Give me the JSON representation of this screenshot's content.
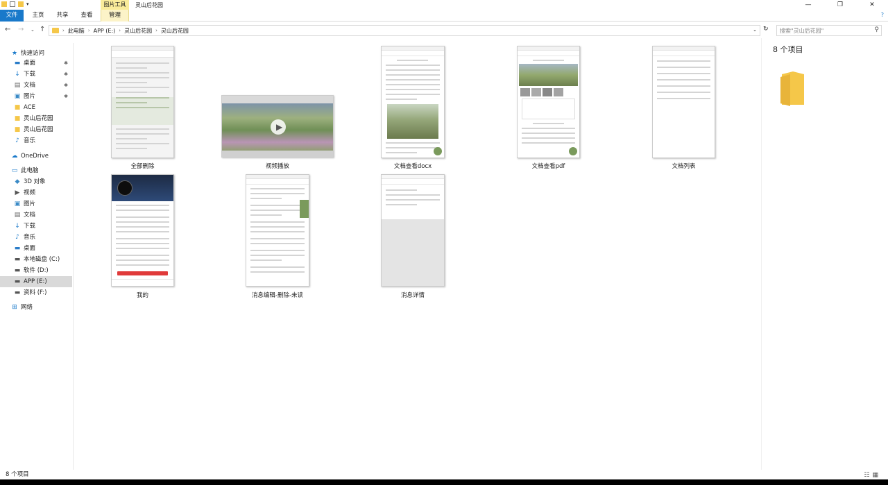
{
  "window": {
    "context_tab": "图片工具",
    "title": "灵山后花园",
    "buttons": [
      "—",
      "❐",
      "✕"
    ]
  },
  "ribbon": {
    "tabs": [
      "文件",
      "主页",
      "共享",
      "查看",
      "管理"
    ],
    "help": "?"
  },
  "address": {
    "crumbs": [
      "此电脑",
      "APP (E:)",
      "灵山后花园",
      "灵山后花园"
    ],
    "search_placeholder": "搜索\"灵山后花园\""
  },
  "nav": {
    "items": [
      {
        "label": "快速访问",
        "icon": "star-icon"
      },
      {
        "label": "桌面",
        "icon": "desktop-icon",
        "pinned": true
      },
      {
        "label": "下载",
        "icon": "download-icon",
        "pinned": true
      },
      {
        "label": "文档",
        "icon": "document-icon",
        "pinned": true
      },
      {
        "label": "图片",
        "icon": "picture-icon",
        "pinned": true
      },
      {
        "label": "ACE",
        "icon": "folder-icon"
      },
      {
        "label": "灵山后花园",
        "icon": "folder-icon"
      },
      {
        "label": "灵山后花园",
        "icon": "folder-icon"
      },
      {
        "label": "音乐",
        "icon": "music-icon"
      },
      {
        "label": "OneDrive",
        "icon": "cloud-icon"
      },
      {
        "label": "此电脑",
        "icon": "pc-icon"
      },
      {
        "label": "3D 对象",
        "icon": "cube-icon"
      },
      {
        "label": "视频",
        "icon": "video-icon"
      },
      {
        "label": "图片",
        "icon": "picture-icon"
      },
      {
        "label": "文档",
        "icon": "document-icon"
      },
      {
        "label": "下载",
        "icon": "download-icon"
      },
      {
        "label": "音乐",
        "icon": "music-icon"
      },
      {
        "label": "桌面",
        "icon": "desktop-icon"
      },
      {
        "label": "本地磁盘 (C:)",
        "icon": "drive-icon"
      },
      {
        "label": "软件 (D:)",
        "icon": "drive-icon"
      },
      {
        "label": "APP (E:)",
        "icon": "drive-icon",
        "selected": true
      },
      {
        "label": "资料 (F:)",
        "icon": "drive-icon"
      },
      {
        "label": "网络",
        "icon": "network-icon"
      }
    ]
  },
  "files": [
    {
      "name": "全部删除"
    },
    {
      "name": "视频播放"
    },
    {
      "name": "文档查看docx"
    },
    {
      "name": "文档查看pdf"
    },
    {
      "name": "文档列表"
    },
    {
      "name": "我的"
    },
    {
      "name": "消息编辑-删除-未读"
    },
    {
      "name": "消息详情"
    }
  ],
  "details": {
    "count_label": "8 个项目"
  },
  "status": {
    "count_label": "8 个项目"
  },
  "colors": {
    "accent": "#1979ca",
    "folder": "#f5c749",
    "context_tab": "#f9eb9a",
    "app_green": "#7a9a5c"
  }
}
